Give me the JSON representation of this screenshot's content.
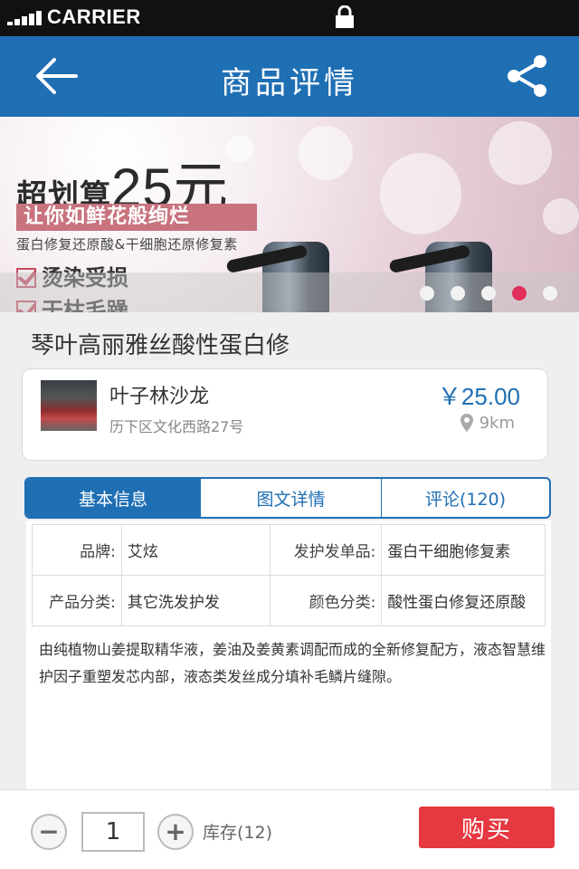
{
  "status_bar": {
    "carrier": "CARRIER",
    "icons": [
      "signal-icon",
      "lock-icon"
    ]
  },
  "header": {
    "title": "商品评情",
    "back_icon": "back-arrow-icon",
    "share_icon": "share-icon",
    "color": "#1f6fb4"
  },
  "banner": {
    "headline": "超划算",
    "price_big": "25元",
    "tagline": "让你如鲜花般绚烂",
    "subline": "蛋白修复还原酸&干细胞还原修复素",
    "checks": [
      "烫染受损",
      "干枯毛躁"
    ],
    "dots_total": 5,
    "dots_active_index": 3,
    "accent": "#e0305a"
  },
  "product": {
    "name": "琴叶高丽雅丝酸性蛋白修"
  },
  "shop": {
    "name": "叶子林沙龙",
    "address": "历下区文化西路27号",
    "price": "￥25.00",
    "distance": "9km"
  },
  "tabs": [
    {
      "label": "基本信息",
      "active": true
    },
    {
      "label": "图文详情",
      "active": false
    },
    {
      "label": "评论(120)",
      "active": false
    }
  ],
  "specs": [
    {
      "label": "品牌:",
      "value": "艾炫",
      "label2": "发护发单品:",
      "value2": "蛋白干细胞修复素"
    },
    {
      "label": "产品分类:",
      "value": "其它洗发护发",
      "label2": "颜色分类:",
      "value2": "酸性蛋白修复还原酸"
    }
  ],
  "description": "由纯植物山姜提取精华液，姜油及姜黄素调配而成的全新修复配方，液态智慧维护因子重塑发芯内部，液态类发丝成分填补毛鳞片缝隙。",
  "bottom_bar": {
    "minus": "−",
    "quantity": "1",
    "plus": "+",
    "stock": "库存(12)",
    "buy_label": "购买",
    "buy_color": "#e53840"
  }
}
